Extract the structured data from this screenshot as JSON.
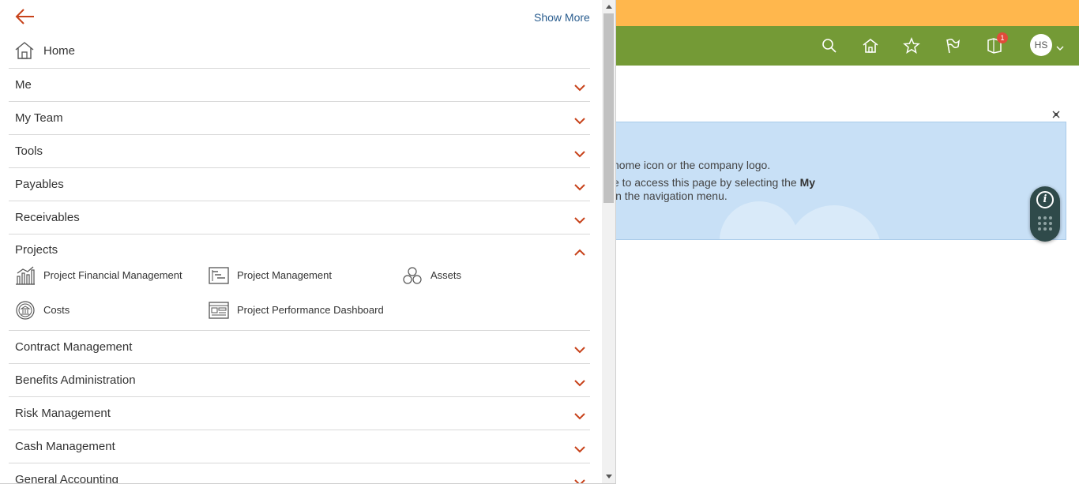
{
  "header": {
    "avatar_initials": "HS",
    "notifications_count": "1"
  },
  "banner": {
    "line1": "home icon or the company logo.",
    "line2_prefix": "e to access this page by selecting the ",
    "line2_bold": "My",
    "line3": " in the navigation menu."
  },
  "nav": {
    "show_more": "Show More",
    "home": "Home",
    "categories": [
      {
        "label": "Me"
      },
      {
        "label": "My Team"
      },
      {
        "label": "Tools"
      },
      {
        "label": "Payables"
      },
      {
        "label": "Receivables"
      },
      {
        "label": "Projects"
      },
      {
        "label": "Contract Management"
      },
      {
        "label": "Benefits Administration"
      },
      {
        "label": "Risk Management"
      },
      {
        "label": "Cash Management"
      },
      {
        "label": "General Accounting"
      }
    ],
    "projects_items": [
      {
        "label": "Project Financial Management"
      },
      {
        "label": "Project Management"
      },
      {
        "label": "Assets"
      },
      {
        "label": "Costs"
      },
      {
        "label": "Project Performance Dashboard"
      }
    ]
  },
  "colors": {
    "accent": "#c7421a",
    "topband": "#ffb74d",
    "header": "#749a36",
    "banner": "#c8e0f6",
    "link": "#2a5d8f"
  }
}
